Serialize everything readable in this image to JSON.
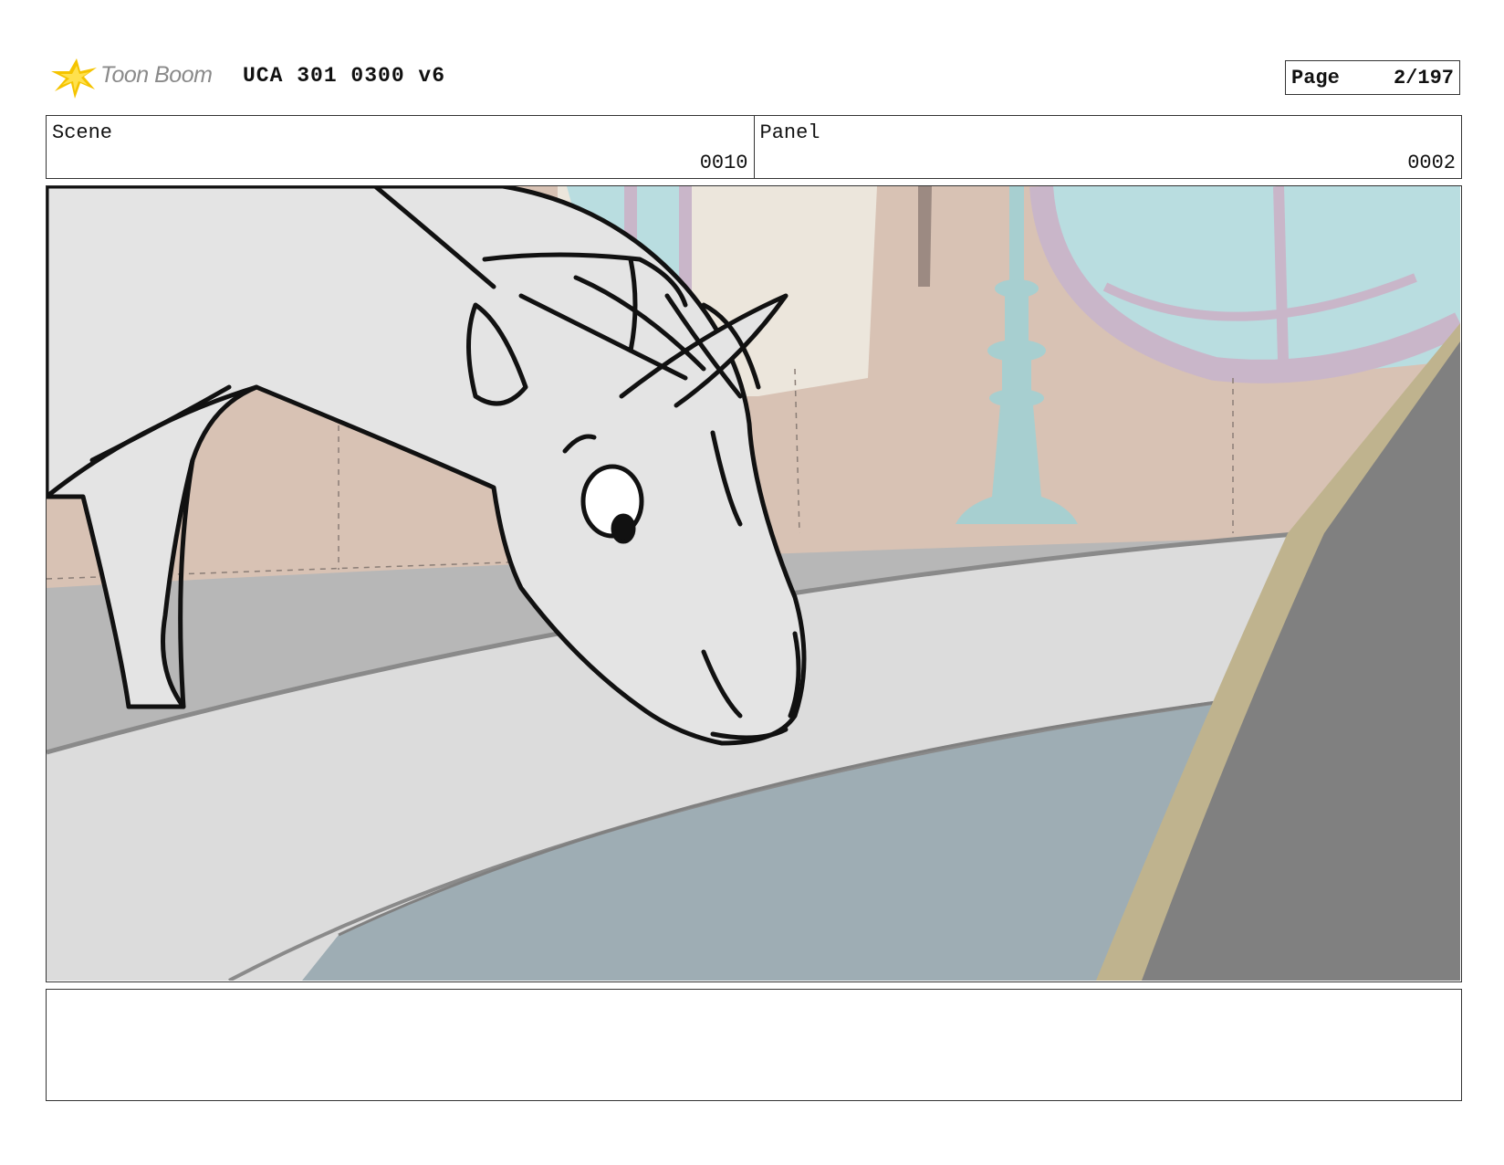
{
  "header": {
    "logo_text": "Toon Boom",
    "doc_title": "UCA 301 0300 v6",
    "page_label": "Page",
    "page_value": "2/197"
  },
  "scene": {
    "label": "Scene",
    "value": "0010"
  },
  "panel": {
    "label": "Panel",
    "value": "0002"
  },
  "notes": {
    "text": ""
  },
  "colors": {
    "logo_yellow": "#f5c400",
    "wall_beige": "#d8c2b4",
    "window_teal": "#b9dde0",
    "frame_lilac": "#c9b6c9",
    "pole_teal": "#a7cfd0",
    "horse_fill": "#e4e4e4",
    "rim_gray": "#d9d9d9",
    "water_blue": "#9eadb4",
    "shadow_gray": "#808080"
  },
  "icons": {
    "logo": "toon-boom-star-icon"
  }
}
